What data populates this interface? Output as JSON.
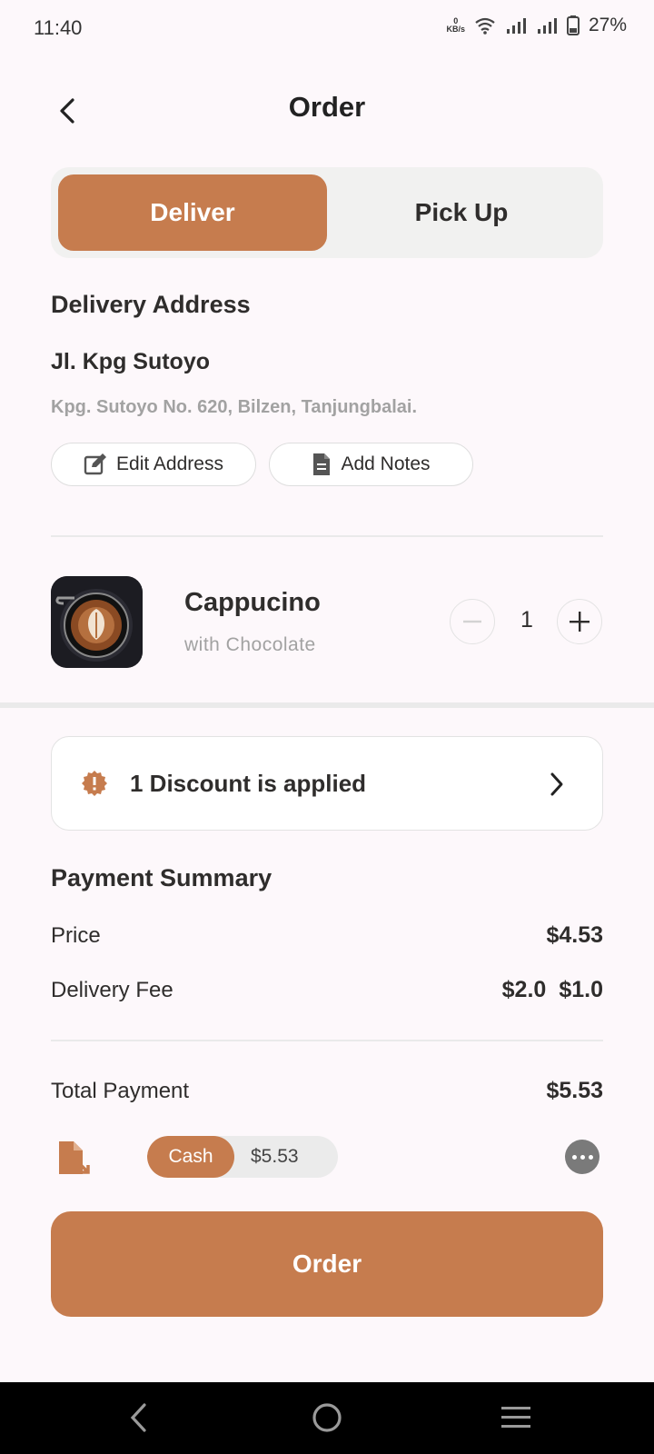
{
  "status": {
    "time": "11:40",
    "net_speed": "0",
    "net_unit": "KB/s",
    "battery": "27%"
  },
  "header": {
    "title": "Order"
  },
  "toggle": {
    "deliver": "Deliver",
    "pickup": "Pick Up",
    "active": "Deliver"
  },
  "address": {
    "section_title": "Delivery Address",
    "name": "Jl. Kpg Sutoyo",
    "detail": "Kpg. Sutoyo No. 620, Bilzen, Tanjungbalai.",
    "edit_label": "Edit Address",
    "notes_label": "Add Notes"
  },
  "product": {
    "name": "Cappucino",
    "variant": "with Chocolate",
    "quantity": "1"
  },
  "discount": {
    "text": "1 Discount is applied"
  },
  "summary": {
    "title": "Payment Summary",
    "price_label": "Price",
    "price_value": "$4.53",
    "delivery_label": "Delivery Fee",
    "delivery_original": "$2.0",
    "delivery_value": "$1.0",
    "total_label": "Total Payment",
    "total_value": "$5.53"
  },
  "payment": {
    "method": "Cash",
    "amount": "$5.53"
  },
  "order_button": "Order",
  "colors": {
    "accent": "#C67C4E",
    "background": "#FDF8FB",
    "text": "#2F2D2C"
  }
}
